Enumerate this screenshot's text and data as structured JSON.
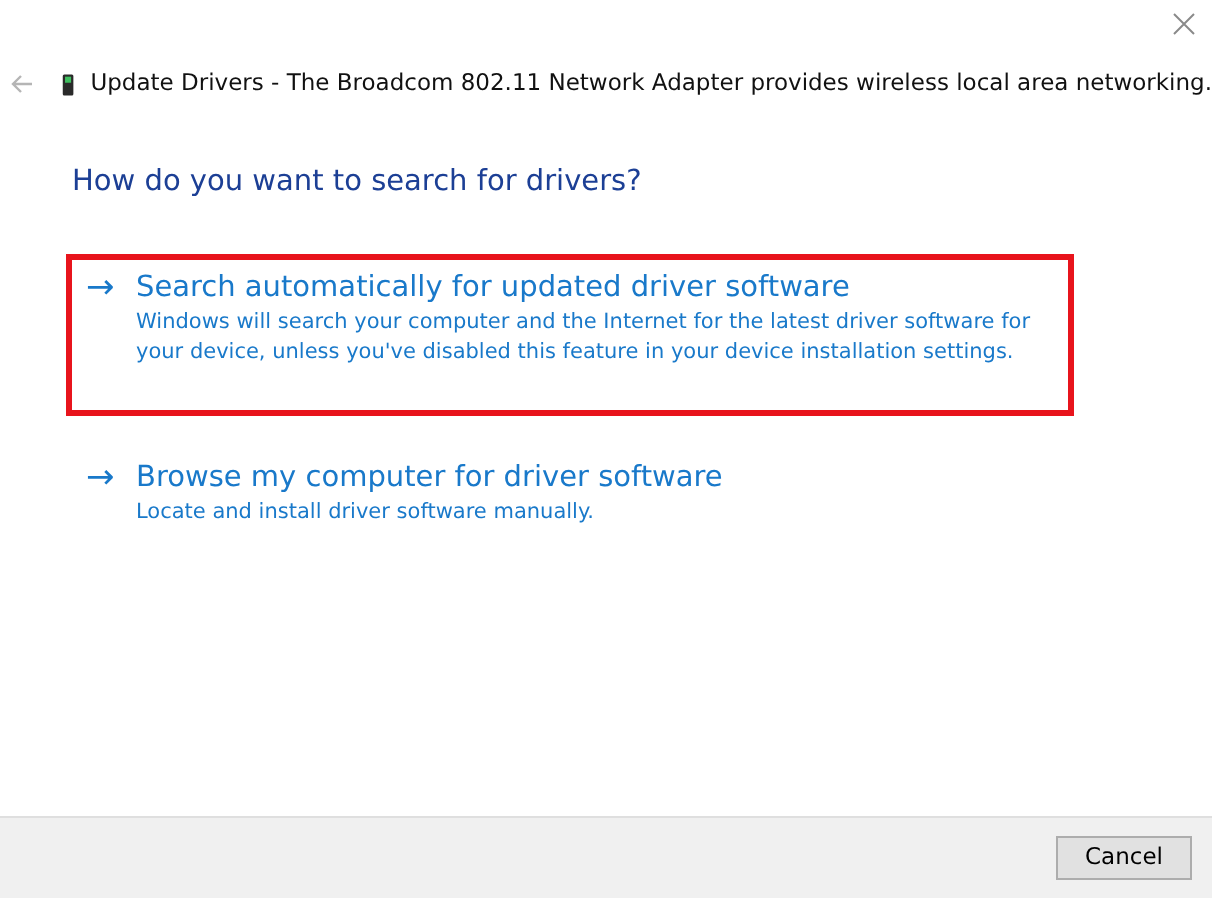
{
  "window": {
    "title": "Update Drivers - The Broadcom 802.11 Network Adapter provides wireless local area networking."
  },
  "heading": "How do you want to search for drivers?",
  "options": [
    {
      "arrow": "→",
      "title": "Search automatically for updated driver software",
      "description": "Windows will search your computer and the Internet for the latest driver software for your device, unless you've disabled this feature in your device installation settings.",
      "highlighted": true
    },
    {
      "arrow": "→",
      "title": "Browse my computer for driver software",
      "description": "Locate and install driver software manually.",
      "highlighted": false
    }
  ],
  "buttons": [
    "Cancel"
  ]
}
